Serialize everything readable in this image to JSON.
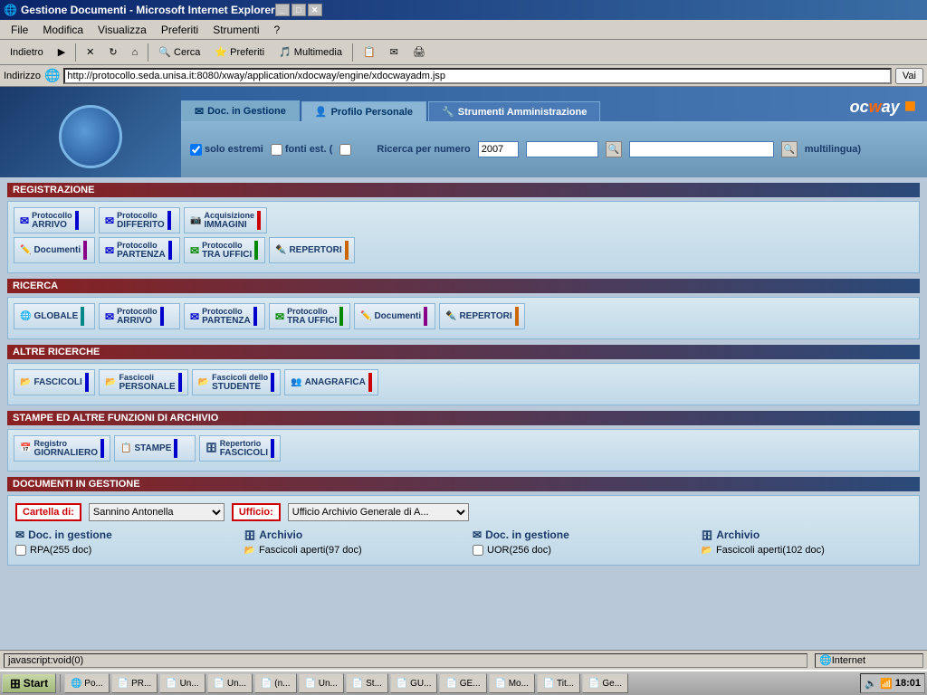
{
  "window": {
    "title": "Gestione Documenti - Microsoft Internet Explorer",
    "controls": [
      "_",
      "□",
      "✕"
    ]
  },
  "menubar": {
    "items": [
      "File",
      "Modifica",
      "Visualizza",
      "Preferiti",
      "Strumenti",
      "?"
    ]
  },
  "toolbar": {
    "back": "Indietro",
    "forward": "▶",
    "stop": "✕",
    "refresh": "↻",
    "home": "⌂",
    "search": "Cerca",
    "favorites": "Preferiti",
    "multimedia": "Multimedia"
  },
  "addressbar": {
    "label": "Indirizzo",
    "url": "http://protocollo.seda.unisa.it:8080/xway/application/xdocway/engine/xdocwayadm.jsp",
    "go": "Vai"
  },
  "tabs": [
    {
      "id": "doc-gestione-tab",
      "label": "Doc. in Gestione",
      "active": false
    },
    {
      "id": "profilo-tab",
      "label": "Profilo Personale",
      "active": true
    },
    {
      "id": "strumenti-tab",
      "label": "Strumenti Amministrazione",
      "active": false
    }
  ],
  "logo": "ocway",
  "search": {
    "label": "Ricerca per numero",
    "year": "2007",
    "year_placeholder": "",
    "num_placeholder": "",
    "checkbox1_label": "solo estremi",
    "checkbox2_label": "fonti est. (",
    "checkbox3_label": "multilingua)",
    "search2_placeholder": ""
  },
  "sections": {
    "registrazione": {
      "title": "REGISTRAZIONE",
      "buttons": [
        {
          "id": "protocollo-arrivo",
          "label": "Protocollo ARRIVO",
          "color": "blue"
        },
        {
          "id": "protocollo-differito",
          "label": "Protocollo DIFFERITO",
          "color": "blue"
        },
        {
          "id": "acquisizione-immagini",
          "label": "Acquisizione IMMAGINI",
          "color": "red"
        },
        {
          "id": "documenti",
          "label": "Documenti",
          "color": "purple"
        },
        {
          "id": "protocollo-partenza",
          "label": "Protocollo PARTENZA",
          "color": "blue"
        },
        {
          "id": "protocollo-tra-uffici",
          "label": "Protocollo TRA UFFICI",
          "color": "green"
        },
        {
          "id": "repertori",
          "label": "REPERTORI",
          "color": "orange"
        }
      ]
    },
    "ricerca": {
      "title": "RICERCA",
      "buttons": [
        {
          "id": "globale",
          "label": "GLOBALE",
          "color": "teal"
        },
        {
          "id": "prot-arrivo",
          "label": "Protocollo ARRIVO",
          "color": "blue"
        },
        {
          "id": "prot-partenza",
          "label": "Protocollo PARTENZA",
          "color": "blue"
        },
        {
          "id": "prot-tra-uffici",
          "label": "Protocollo TRA UFFICI",
          "color": "green"
        },
        {
          "id": "doc-search",
          "label": "Documenti",
          "color": "purple"
        },
        {
          "id": "repertori-search",
          "label": "REPERTORI",
          "color": "orange"
        }
      ]
    },
    "altre_ricerche": {
      "title": "ALTRE RICERCHE",
      "buttons": [
        {
          "id": "fascicoli",
          "label": "FASCICOLI",
          "color": "blue"
        },
        {
          "id": "fascicoli-personale",
          "label": "Fascicoli PERSONALE",
          "color": "blue"
        },
        {
          "id": "fascicoli-studente",
          "label": "Fascicoli dello STUDENTE",
          "color": "blue"
        },
        {
          "id": "anagrafica",
          "label": "ANAGRAFICA",
          "color": "red"
        }
      ]
    },
    "stampe": {
      "title": "STAMPE ED ALTRE FUNZIONI DI ARCHIVIO",
      "buttons": [
        {
          "id": "registro-giornaliero",
          "label": "Registro GIORNALIERO",
          "color": "blue"
        },
        {
          "id": "stampe",
          "label": "STAMPE",
          "color": "blue"
        },
        {
          "id": "repertorio-fascicoli",
          "label": "Repertorio FASCICOLI",
          "color": "blue"
        }
      ]
    },
    "documenti_gestione": {
      "title": "DOCUMENTI IN GESTIONE",
      "cartella_label": "Cartella di:",
      "ufficio_label": "Ufficio:",
      "cartella_value": "Sannino Antonella",
      "ufficio_value": "Ufficio Archivio Generale di A...",
      "col1_title": "Doc. in gestione",
      "col1_items": [
        "RPA(255 doc)"
      ],
      "col2_title": "Archivio",
      "col2_items": [
        "Fascicoli aperti(97 doc)"
      ],
      "col3_title": "Doc. in gestione",
      "col3_items": [
        "UOR(256 doc)"
      ],
      "col4_title": "Archivio",
      "col4_items": [
        "Fascicoli aperti(102 doc)"
      ]
    }
  },
  "statusbar": {
    "status": "javascript:void(0)",
    "zone": "Internet"
  },
  "taskbar": {
    "start": "Start",
    "items": [
      "Po...",
      "PR...",
      "Un...",
      "Un...",
      "(n...",
      "Un...",
      "St...",
      "GU...",
      "GE...",
      "Mo...",
      "Tit...",
      "Ge..."
    ],
    "time": "18:01"
  }
}
